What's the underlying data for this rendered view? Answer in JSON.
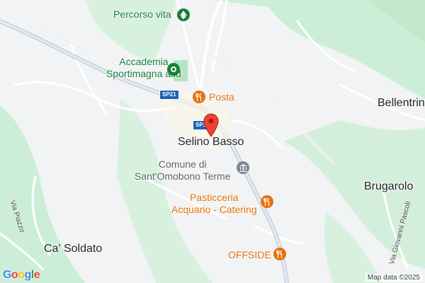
{
  "map": {
    "colors": {
      "background": "#f1f3f4",
      "vegetation": "#cdeed6",
      "road": "#ffffff",
      "road_casing": "#d6dadf",
      "main_road": "#b8c4d4",
      "poi_green": "#188038",
      "poi_orange": "#e8710a",
      "pin_red": "#ea4335"
    },
    "places": {
      "selino_basso": "Selino Basso",
      "brugarolo": "Brugarolo",
      "ca_soldato": "Ca' Soldato",
      "bellentrino": "Bellentrin"
    },
    "pois": {
      "percorso_vita": "Percorso vita",
      "accademia_line1": "Accademia",
      "accademia_line2": "Sportimagna asd",
      "posta": "Posta",
      "comune_line1": "Comune di",
      "comune_line2": "Sant'Omobono Terme",
      "pasticceria_line1": "Pasticceria",
      "pasticceria_line2": "Acquario - Catering",
      "offside": "OFFSIDE"
    },
    "streets": {
      "via_piazzo": "Via Piazzo",
      "via_giovanni_pascoli": "Via Giovanni Pascoli"
    },
    "routes": {
      "sp21_a": "SP21",
      "sp21_b": "SP1"
    },
    "icons": {
      "tree": "tree-icon",
      "park": "park-icon",
      "restaurant": "restaurant-icon",
      "government": "government-icon",
      "pin": "location-pin-icon"
    },
    "attribution": "Map data ©2025",
    "logo": "Google"
  }
}
